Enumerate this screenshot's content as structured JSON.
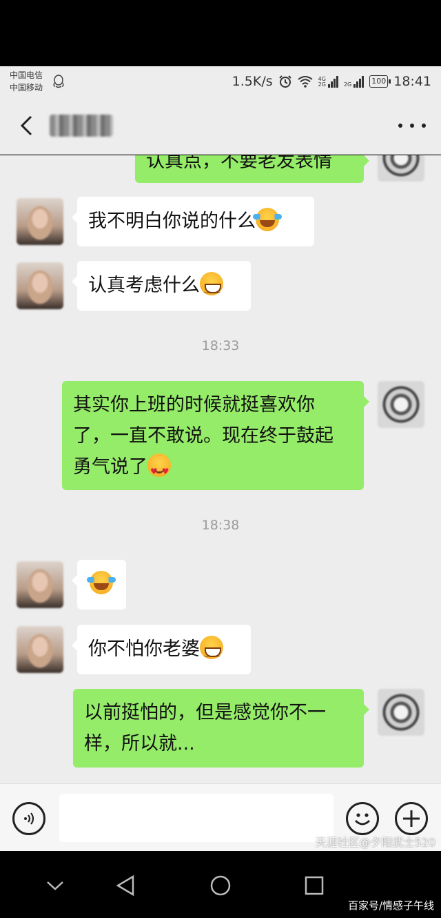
{
  "status_bar": {
    "carrier_1": "中国电信",
    "carrier_2": "中国移动",
    "net_speed": "1.5K/s",
    "signal_1_label": "4G",
    "signal_1_sub": "2G",
    "signal_2_label": "2G",
    "battery": "100",
    "time": "18:41"
  },
  "header": {
    "contact_name": "▇▇▇"
  },
  "messages": {
    "m0": {
      "text": "认真点，不要老发表情"
    },
    "m1": {
      "text": "我不明白你说的什么"
    },
    "m2": {
      "text": "认真考虑什么"
    },
    "t1": "18:33",
    "m3": {
      "line1": "其实你上班的时候就挺喜欢你",
      "line2": "了，一直不敢说。现在终于鼓起",
      "line3": "勇气说了"
    },
    "t2": "18:38",
    "m5": {
      "text": "你不怕你老婆"
    },
    "m6": {
      "line1": "以前挺怕的，但是感觉你不一",
      "line2": "样，所以就..."
    }
  },
  "icons": {
    "back": "back-arrow-icon",
    "more": "more-dots-icon",
    "voice": "voice-icon",
    "emoji": "emoji-icon",
    "plus": "plus-icon",
    "emoji_laugh_cry": "laugh-cry-emoji-icon",
    "emoji_grin": "grin-emoji-icon",
    "emoji_heart_eyes": "heart-eyes-emoji-icon"
  },
  "colors": {
    "outgoing_bubble": "#95ec69",
    "incoming_bubble": "#ffffff",
    "chat_background": "#ededed"
  },
  "watermarks": {
    "tianya": "天涯社区@夕阳武士520",
    "baijia": "百家号/情感子午线"
  }
}
